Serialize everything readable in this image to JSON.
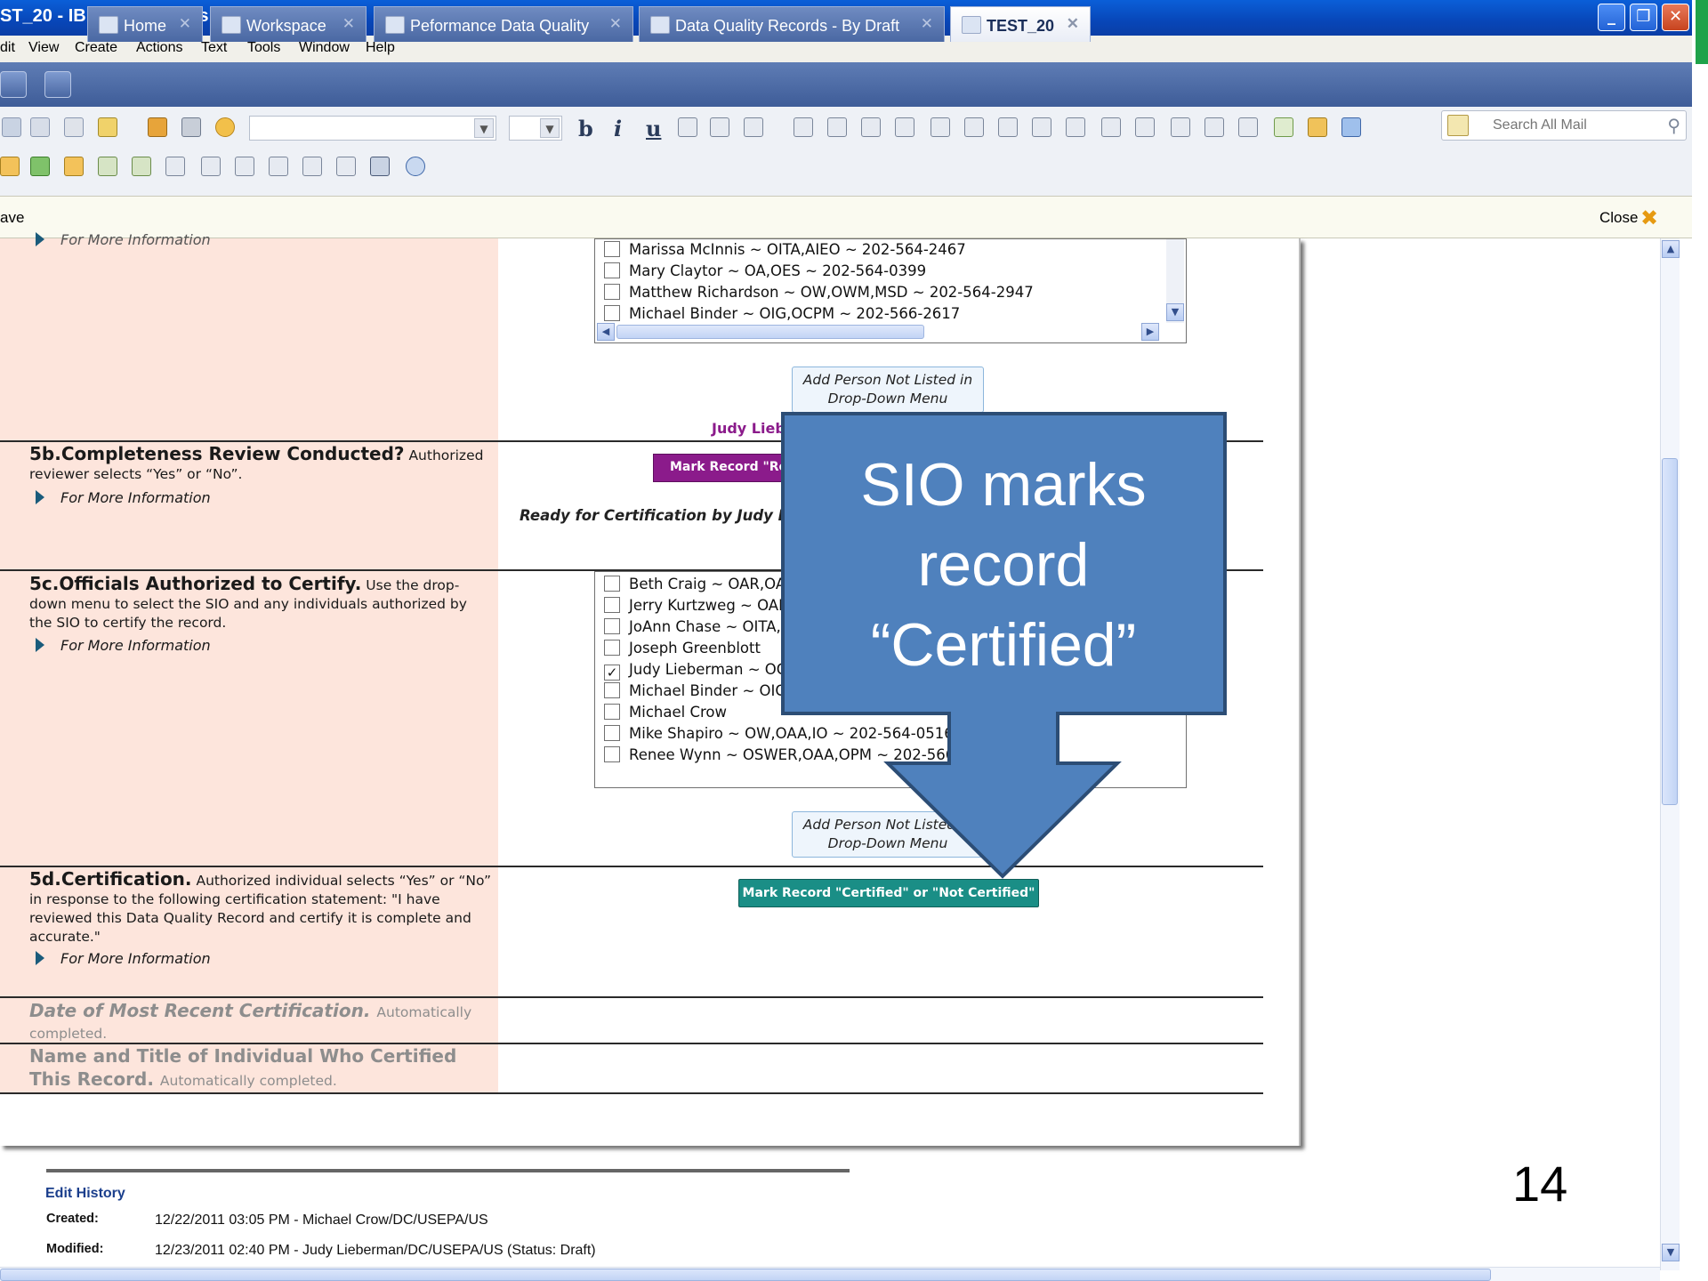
{
  "window": {
    "title": "ST_20 - IBM Lotus Notes"
  },
  "menu": [
    "dit",
    "View",
    "Create",
    "Actions",
    "Text",
    "Tools",
    "Window",
    "Help"
  ],
  "tabs": [
    {
      "label": "Home"
    },
    {
      "label": "Workspace"
    },
    {
      "label": "Peformance Data Quality"
    },
    {
      "label": "Data Quality Records - By Draft"
    },
    {
      "label": "TEST_20",
      "active": true
    }
  ],
  "toolbar": {
    "bold": "b",
    "italic": "i",
    "underline": "u"
  },
  "search": {
    "placeholder": "Search All Mail"
  },
  "actionbar": {
    "save_label": "ave",
    "close_label": "Close"
  },
  "form": {
    "top_more": "For More Information",
    "list1": [
      {
        "text": "Marissa McInnis ~ OITA,AIEO ~ 202-564-2467",
        "checked": false
      },
      {
        "text": "Mary Claytor ~ OA,OES ~ 202-564-0399",
        "checked": false
      },
      {
        "text": "Matthew Richardson ~ OW,OWM,MSD ~ 202-564-2947",
        "checked": false
      },
      {
        "text": "Michael Binder ~ OIG,OCPM ~ 202-566-2617",
        "checked": false
      }
    ],
    "add_person_label": "Add Person Not Listed in Drop-Down Menu",
    "add_person_label_2": "Add Person Not Listed in Drop-Down Menu",
    "judy_label": "Judy Lieb",
    "s5b": {
      "title": "5b.Completeness Review Conducted?",
      "text": "Authorized reviewer selects “Yes” or “No”.",
      "more": "For More Information",
      "button": "Mark Record \"Rea",
      "status": "Ready for Certification by Judy Lieb"
    },
    "s5c": {
      "title": "5c.Officials Authorized to Certify.",
      "text": "Use the drop-down menu to select the SIO and any individuals authorized by the SIO to certify the record.",
      "more": "For More Information",
      "list": [
        {
          "text": "Beth Craig ~ OAR,OAA",
          "checked": false
        },
        {
          "text": "Jerry Kurtzweg ~ OAR,",
          "checked": false
        },
        {
          "text": "JoAnn Chase ~ OITA,A",
          "checked": false
        },
        {
          "text": "Joseph Greenblott",
          "checked": false
        },
        {
          "text": "Judy Lieberman ~ OC",
          "checked": true
        },
        {
          "text": "Michael Binder ~ OIG",
          "checked": false
        },
        {
          "text": "Michael Crow",
          "checked": false
        },
        {
          "text": "Mike Shapiro ~ OW,OAA,IO ~ 202-564-0516",
          "checked": false
        },
        {
          "text": "Renee Wynn ~ OSWER,OAA,OPM ~ 202-566-1",
          "checked": false
        }
      ]
    },
    "s5d": {
      "title": "5d.Certification.",
      "text": "Authorized individual selects “Yes” or “No” in response to the following certification statement: \"I have reviewed this Data Quality Record and certify it is complete and accurate.\"",
      "more": "For More Information",
      "button": "Mark Record \"Certified\" or \"Not Certified\""
    },
    "date_title": "Date of Most Recent Certification.",
    "date_text": "Automatically completed.",
    "name_title": "Name and Title of Individual Who Certified This Record.",
    "name_text": "Automatically completed."
  },
  "edit_history": {
    "title": "Edit History",
    "created_label": "Created:",
    "created_value": "12/22/2011 03:05 PM - Michael Crow/DC/USEPA/US",
    "modified_label": "Modified:",
    "modified_value": "12/23/2011 02:40 PM - Judy Lieberman/DC/USEPA/US (Status: Draft)"
  },
  "slide_number": "14",
  "callout": {
    "line1": "SIO marks",
    "line2": "record",
    "line3": "“Certified”",
    "fill": "#4f81bd",
    "border": "#2c4d75"
  }
}
